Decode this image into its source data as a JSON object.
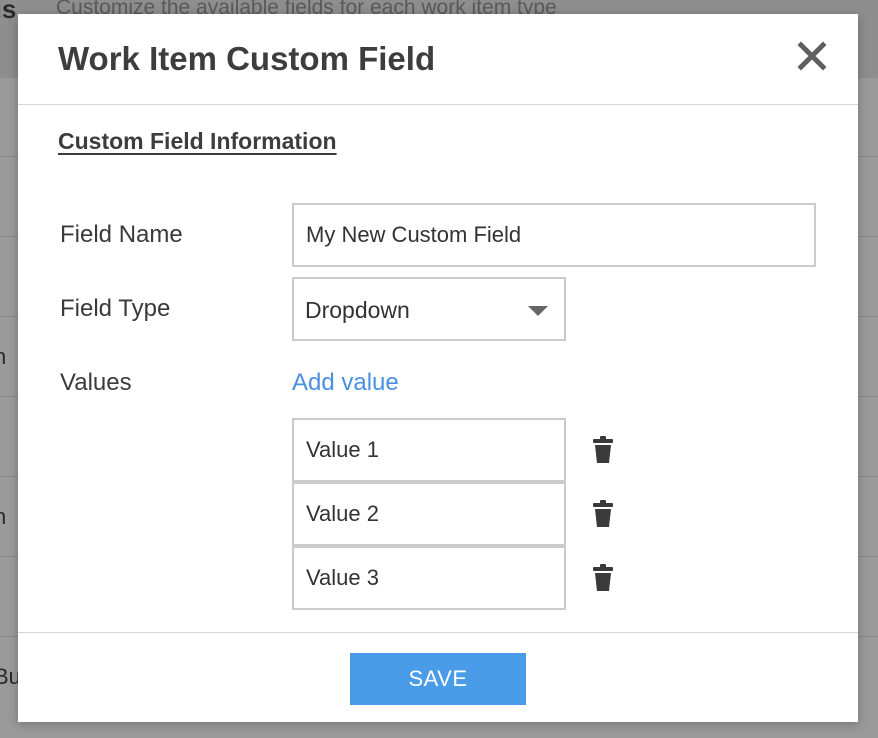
{
  "background": {
    "title_fragment": "gs",
    "subtitle": "Customize the available fields for each work item type",
    "row_fragments": [
      "n",
      "n",
      "Bu"
    ]
  },
  "modal": {
    "title": "Work Item Custom Field",
    "close_icon": "close-icon",
    "section_title": "Custom Field Information",
    "field_name": {
      "label": "Field Name",
      "value": "My New Custom Field"
    },
    "field_type": {
      "label": "Field Type",
      "selected": "Dropdown"
    },
    "values": {
      "label": "Values",
      "add_link": "Add value",
      "items": [
        "Value 1",
        "Value 2",
        "Value 3"
      ],
      "delete_icon": "trash-icon"
    },
    "save_label": "SAVE"
  },
  "colors": {
    "accent": "#4a9be8",
    "link": "#4a90e2",
    "title": "#3d3d3d",
    "overlay": "#8f8f8f"
  }
}
